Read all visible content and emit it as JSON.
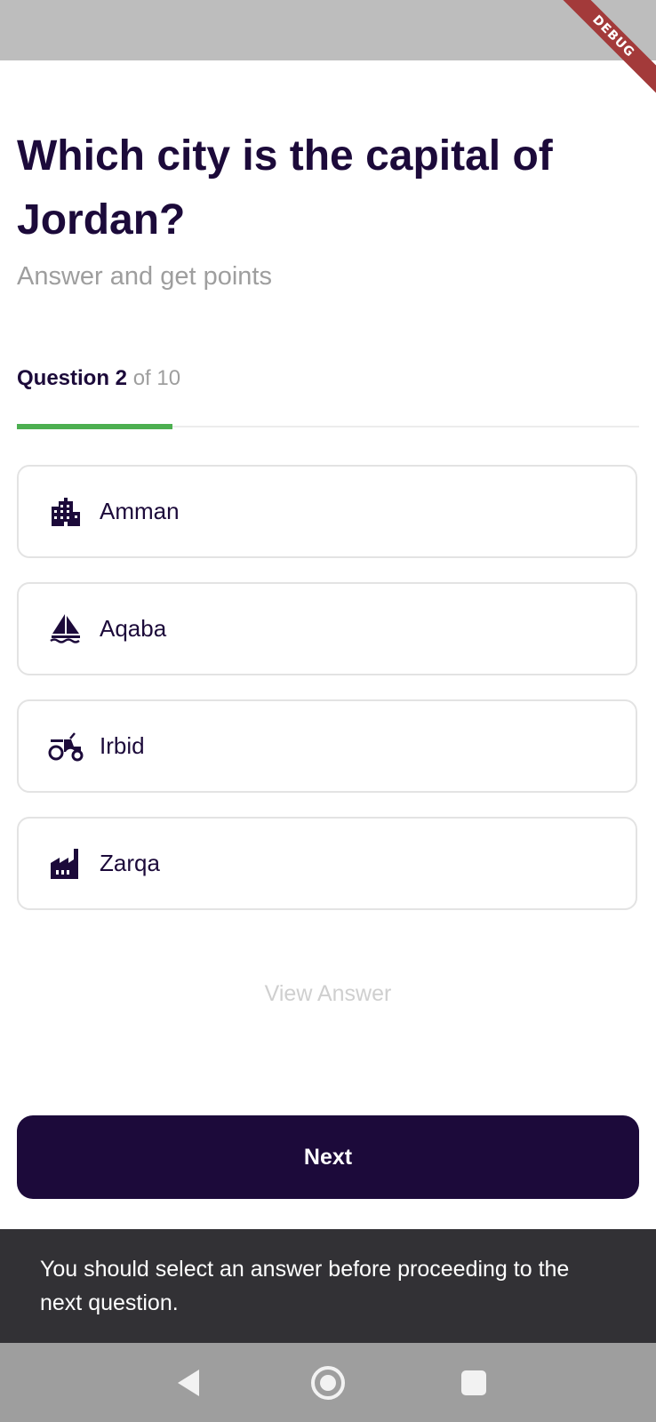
{
  "banner": {
    "debug": "DEBUG"
  },
  "quiz": {
    "question": "Which city is the capital of Jordan?",
    "subtitle": "Answer and get points",
    "counter_current": "Question 2",
    "counter_total": " of 10",
    "progress": 0.25
  },
  "options": [
    {
      "label": "Amman",
      "icon": "city-buildings-icon"
    },
    {
      "label": "Aqaba",
      "icon": "sailboat-icon"
    },
    {
      "label": "Irbid",
      "icon": "tractor-icon"
    },
    {
      "label": "Zarqa",
      "icon": "factory-icon"
    }
  ],
  "actions": {
    "view_answer": "View Answer",
    "next": "Next"
  },
  "snackbar": {
    "message": "You should select an answer before proceeding to the next question."
  },
  "colors": {
    "primary": "#1c0a3a",
    "progress": "#4caf50",
    "muted": "#9e9e9e",
    "snackbar_bg": "#323135"
  }
}
